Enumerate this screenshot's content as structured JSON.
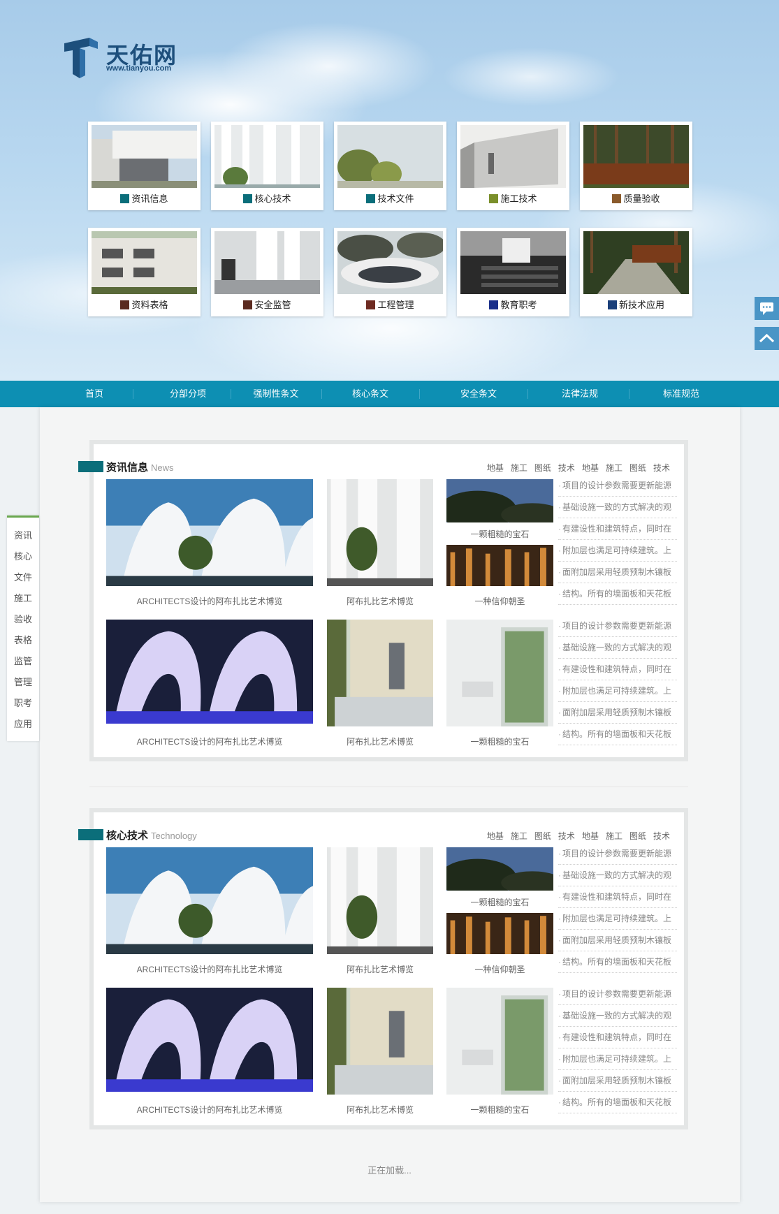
{
  "logo": {
    "name": "天佑网",
    "url": "www.tianyou.com"
  },
  "tiles": [
    {
      "label": "资讯信息",
      "color": "#0b6e7a"
    },
    {
      "label": "核心技术",
      "color": "#0b6e7a"
    },
    {
      "label": "技术文件",
      "color": "#0b6e7a"
    },
    {
      "label": "施工技术",
      "color": "#7a8f2a"
    },
    {
      "label": "质量验收",
      "color": "#8a5a2b"
    },
    {
      "label": "资料表格",
      "color": "#5a2a1f"
    },
    {
      "label": "安全监管",
      "color": "#5a2a1f"
    },
    {
      "label": "工程管理",
      "color": "#6e2b22"
    },
    {
      "label": "教育职考",
      "color": "#1a2f8a"
    },
    {
      "label": "新技术应用",
      "color": "#1a3f7a"
    }
  ],
  "nav": [
    "首页",
    "分部分项",
    "强制性条文",
    "核心条文",
    "安全条文",
    "法律法规",
    "标准规范"
  ],
  "sidemenu": [
    "资讯",
    "核心",
    "文件",
    "施工",
    "验收",
    "表格",
    "监管",
    "管理",
    "职考",
    "应用"
  ],
  "tags": [
    "地基",
    "施工",
    "图纸",
    "技术",
    "地基",
    "施工",
    "图纸",
    "技术"
  ],
  "sections": [
    {
      "title": "资讯信息",
      "subtitle": "News"
    },
    {
      "title": "核心技术",
      "subtitle": "Technology"
    }
  ],
  "captions": {
    "big": "ARCHITECTS设计的阿布扎比艺术博览",
    "mid": "阿布扎比艺术博览",
    "small_top": "一颗粗糙的宝石",
    "small_bottom": "一种信仰朝圣",
    "small_row2": "一颗粗糙的宝石"
  },
  "list_items": [
    "项目的设计参数需要更新能源",
    "基础设施一致的方式解决的观",
    "有建设性和建筑特点，同时在",
    "附加层也满足可持续建筑。上",
    "面附加层采用轻质预制木镶板",
    "结构。所有的墙面板和天花板"
  ],
  "loading": "正在加载...",
  "colors": {
    "nav": "#0d8fb3",
    "accent": "#0b6e7a"
  }
}
